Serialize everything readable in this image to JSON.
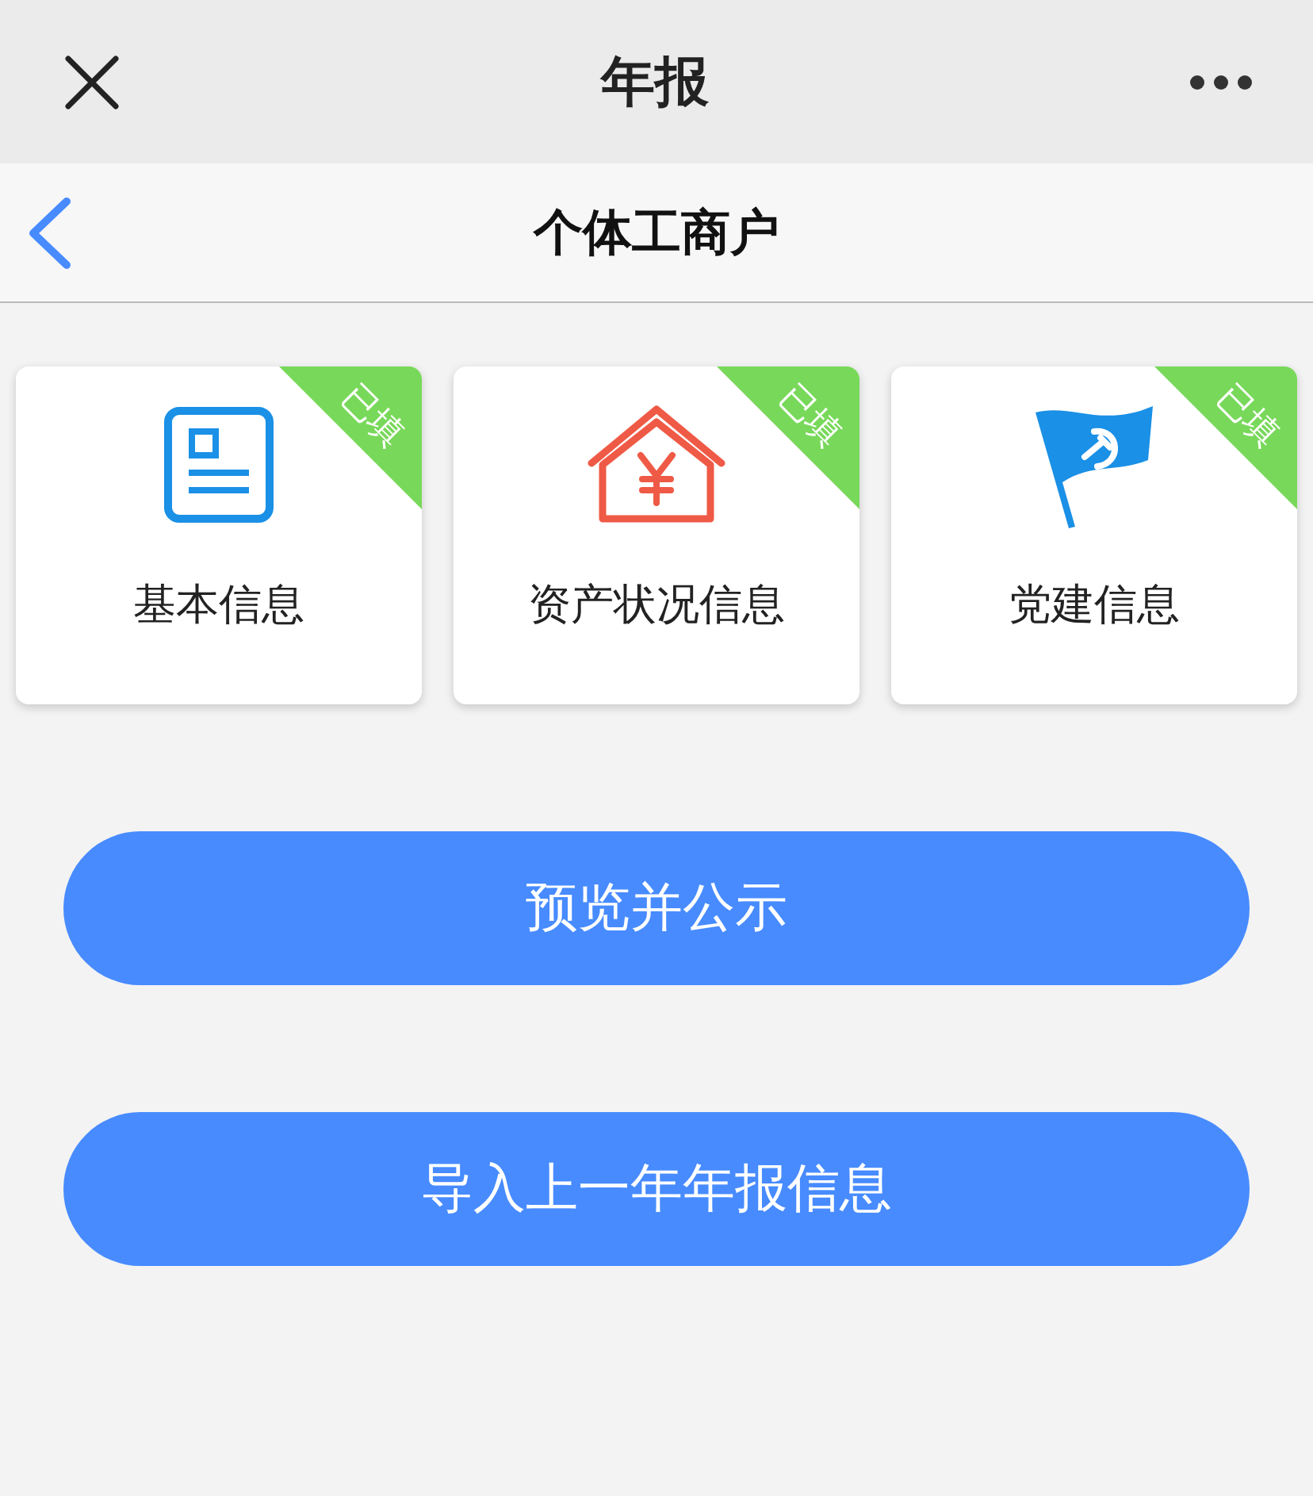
{
  "top_bar": {
    "title": "年报"
  },
  "nav_bar": {
    "title": "个体工商户"
  },
  "cards": [
    {
      "label": "基本信息",
      "filled": true,
      "badge": "已填"
    },
    {
      "label": "资产状况信息",
      "filled": true,
      "badge": "已填"
    },
    {
      "label": "党建信息",
      "filled": true,
      "badge": "已填"
    }
  ],
  "buttons": [
    "预览并公示",
    "导入上一年年报信息"
  ]
}
